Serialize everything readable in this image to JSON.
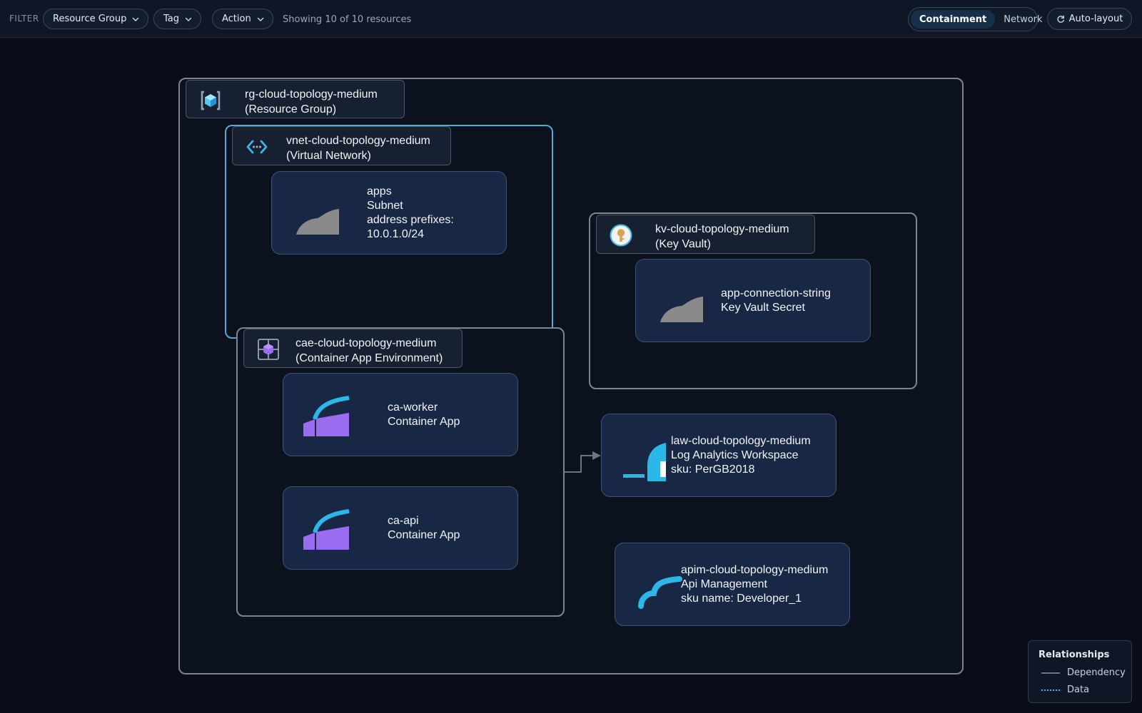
{
  "toolbar": {
    "filter_label": "FILTER",
    "filters": [
      {
        "label": "Resource Group"
      },
      {
        "label": "Tag"
      },
      {
        "label": "Action"
      }
    ],
    "showing_text": "Showing 10 of 10 resources",
    "view_modes": [
      {
        "label": "Containment",
        "active": true
      },
      {
        "label": "Network",
        "active": false
      }
    ],
    "autolayout_label": "Auto-layout"
  },
  "groups": {
    "rg": {
      "name": "rg-cloud-topology-medium",
      "type": "(Resource Group)",
      "icon": "resource-group-icon"
    },
    "vnet": {
      "name": "vnet-cloud-topology-medium",
      "type": "(Virtual Network)",
      "icon": "virtual-network-icon"
    },
    "kv": {
      "name": "kv-cloud-topology-medium",
      "type": "(Key Vault)",
      "icon": "key-vault-icon"
    },
    "cae": {
      "name": "cae-cloud-topology-medium",
      "type": "(Container App Environment)",
      "icon": "container-app-environment-icon"
    }
  },
  "nodes": {
    "subnet": {
      "lines": [
        "apps",
        "Subnet",
        "address prefixes:",
        "10.0.1.0/24"
      ],
      "icon": "subnet-icon"
    },
    "secret": {
      "lines": [
        "app-connection-string",
        "Key Vault Secret"
      ],
      "icon": "key-vault-secret-icon"
    },
    "worker": {
      "lines": [
        "ca-worker",
        "Container App"
      ],
      "icon": "container-app-icon"
    },
    "api": {
      "lines": [
        "ca-api",
        "Container App"
      ],
      "icon": "container-app-icon"
    },
    "law": {
      "lines": [
        "law-cloud-topology-medium",
        "Log Analytics Workspace",
        "sku: PerGB2018"
      ],
      "icon": "log-analytics-icon"
    },
    "apim": {
      "lines": [
        "apim-cloud-topology-medium",
        "Api Management",
        "sku name: Developer_1"
      ],
      "icon": "api-management-icon"
    }
  },
  "legend": {
    "title": "Relationships",
    "items": [
      {
        "label": "Dependency",
        "style": "solid",
        "color": "#6b7584"
      },
      {
        "label": "Data",
        "style": "dotted",
        "color": "#3fb6e6"
      }
    ]
  },
  "colors": {
    "background": "#080d17",
    "accent_blue": "#5aa6d6",
    "node_fill": "#182844",
    "container_purple": "#9a6cf0",
    "cyan": "#2bb7e8"
  }
}
